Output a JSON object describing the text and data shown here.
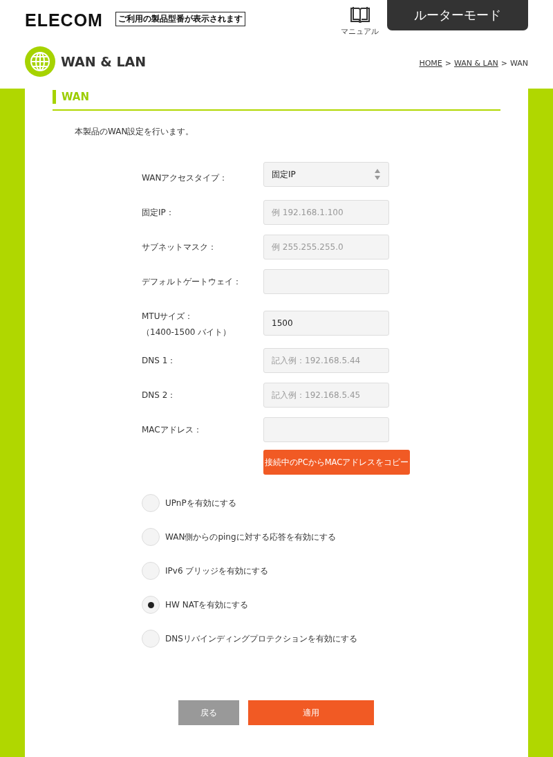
{
  "header": {
    "brand": "ELECOM",
    "model_notice": "ご利用の製品型番が表示されます",
    "manual_label": "マニュアル",
    "mode_button": "ルーターモード"
  },
  "page": {
    "title": "WAN & LAN",
    "breadcrumb_separator": ">",
    "breadcrumb": [
      {
        "label": "HOME",
        "link": true
      },
      {
        "label": "WAN & LAN",
        "link": true
      },
      {
        "label": "WAN",
        "link": false
      }
    ]
  },
  "section": {
    "title": "WAN",
    "description": "本製品のWAN設定を行います。"
  },
  "fields": [
    {
      "kind": "select",
      "label": "WANアクセスタイプ：",
      "value": "固定IP"
    },
    {
      "kind": "text",
      "label": "固定IP：",
      "placeholder": "例 192.168.1.100"
    },
    {
      "kind": "text",
      "label": "サブネットマスク：",
      "placeholder": "例 255.255.255.0"
    },
    {
      "kind": "text",
      "label": "デフォルトゲートウェイ："
    },
    {
      "kind": "text",
      "label": "MTUサイズ：",
      "note": "（1400-1500 バイト）",
      "value": "1500"
    },
    {
      "kind": "text",
      "label": "DNS 1：",
      "placeholder": "記入例：192.168.5.44"
    },
    {
      "kind": "text",
      "label": "DNS 2：",
      "placeholder": "記入例：192.168.5.45"
    },
    {
      "kind": "text",
      "label": "MACアドレス：",
      "button": "接続中のPCからMACアドレスをコピー"
    }
  ],
  "options": [
    {
      "label": "UPnPを有効にする",
      "checked": false
    },
    {
      "label": "WAN側からのpingに対する応答を有効にする",
      "checked": false
    },
    {
      "label": "IPv6 ブリッジを有効にする",
      "checked": false
    },
    {
      "label": "HW NATを有効にする",
      "checked": true
    },
    {
      "label": "DNSリバインディングプロテクションを有効にする",
      "checked": false
    }
  ],
  "buttons": [
    {
      "kind": "back",
      "label": "戻る"
    },
    {
      "kind": "apply",
      "label": "適用"
    }
  ]
}
